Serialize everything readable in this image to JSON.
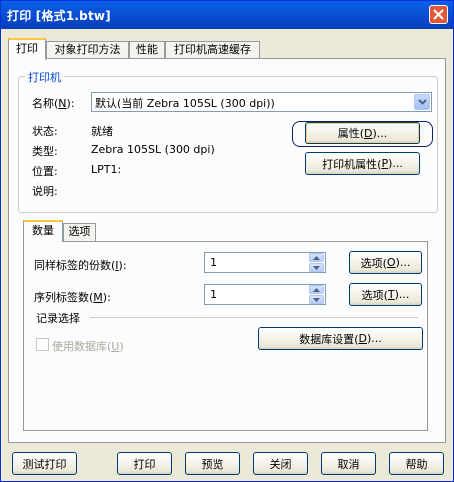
{
  "window": {
    "title": "打印 [格式1.btw]"
  },
  "tabs": [
    "打印",
    "对象打印方法",
    "性能",
    "打印机高速缓存"
  ],
  "printer_group": {
    "legend": "打印机",
    "name_label": "名称(N):",
    "name_value": "默认(当前 Zebra 105SL (300 dpi))",
    "status_label": "状态:",
    "status_value": "就绪",
    "type_label": "类型:",
    "type_value": "Zebra 105SL (300 dpi)",
    "location_label": "位置:",
    "location_value": "LPT1:",
    "comment_label": "说明:",
    "properties_button": "属性(D)...",
    "printer_properties_button": "打印机属性(P)..."
  },
  "inner_tabs": [
    "数量",
    "选项"
  ],
  "quantity": {
    "copies_label": "同样标签的份数(I):",
    "copies_value": "1",
    "copies_options_button": "选项(O)...",
    "serial_label": "序列标签数(M):",
    "serial_value": "1",
    "serial_options_button": "选项(T)..."
  },
  "record_selection": {
    "legend": "记录选择",
    "use_database_label": "使用数据库(U)",
    "db_settings_button": "数据库设置(D)..."
  },
  "footer": {
    "test_print": "测试打印",
    "print": "打印",
    "preview": "预览",
    "close": "关闭",
    "cancel": "取消",
    "help": "帮助"
  }
}
